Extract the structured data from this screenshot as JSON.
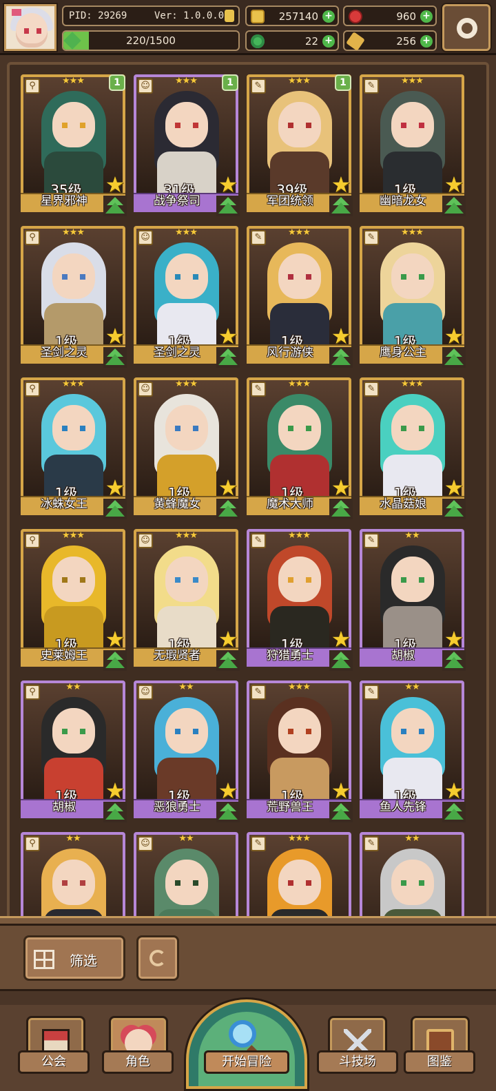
{
  "hud": {
    "pid": "PID: 29269",
    "version": "Ver: 1.0.0.0",
    "exp_text": "220/1500",
    "exp_fraction": 0.147,
    "coins": "257140",
    "gems": "960",
    "clovers": "22",
    "keys": "256",
    "plus": "+",
    "icons": {
      "avatar": "player-avatar",
      "settings": "gear-icon",
      "coin": "coin-icon",
      "gem": "gem-icon",
      "clover": "clover-icon",
      "key": "key-icon"
    }
  },
  "cards": [
    {
      "name": "星界邪神",
      "level": "35级",
      "stars": "★★★",
      "badge": "1",
      "rarity": "gold",
      "hair": "#2f6b5a",
      "body": "#2b4a3c",
      "eyes": "#e0a22a"
    },
    {
      "name": "战争祭司",
      "level": "31级",
      "stars": "★★★",
      "badge": "1",
      "rarity": "purple",
      "hair": "#2b2a33",
      "body": "#d8d2c8",
      "eyes": "#c03636"
    },
    {
      "name": "军团统领",
      "level": "39级",
      "stars": "★★★",
      "badge": "1",
      "rarity": "gold",
      "hair": "#e8c27a",
      "body": "#5a3a2a",
      "eyes": "#b03030"
    },
    {
      "name": "幽暗龙女",
      "level": "1级",
      "stars": "★★★",
      "badge": "",
      "rarity": "gold",
      "hair": "#4a5a52",
      "body": "#2a2d30",
      "eyes": "#c03040"
    },
    {
      "name": "圣剑之灵",
      "level": "1级",
      "stars": "★★★",
      "badge": "",
      "rarity": "gold",
      "hair": "#d9dde8",
      "body": "#b49a6a",
      "eyes": "#4a7ac0"
    },
    {
      "name": "圣剑之灵",
      "level": "1级",
      "stars": "★★★",
      "badge": "",
      "rarity": "gold",
      "hair": "#3ab0c8",
      "body": "#e8e8f0",
      "eyes": "#2a8ab8"
    },
    {
      "name": "风行游侠",
      "level": "1级",
      "stars": "★★★",
      "badge": "",
      "rarity": "gold",
      "hair": "#e7b85a",
      "body": "#2a2d3a",
      "eyes": "#b03040"
    },
    {
      "name": "鹰身公主",
      "level": "1级",
      "stars": "★★★",
      "badge": "",
      "rarity": "gold",
      "hair": "#edd49a",
      "body": "#4aa0a8",
      "eyes": "#3a9a4a"
    },
    {
      "name": "冰蛛女王",
      "level": "1级",
      "stars": "★★★",
      "badge": "",
      "rarity": "gold",
      "hair": "#5ac8dc",
      "body": "#2a3a48",
      "eyes": "#2a80c0"
    },
    {
      "name": "黄蜂魔女",
      "level": "1级",
      "stars": "★★★",
      "badge": "",
      "rarity": "gold",
      "hair": "#e8e4dc",
      "body": "#d4a02a",
      "eyes": "#3a7ac0"
    },
    {
      "name": "魔术大师",
      "level": "1级",
      "stars": "★★★",
      "badge": "",
      "rarity": "gold",
      "hair": "#3a8a68",
      "body": "#b03030",
      "eyes": "#3a9a4a"
    },
    {
      "name": "水晶菇娘",
      "level": "1级",
      "stars": "★★★",
      "badge": "",
      "rarity": "gold",
      "hair": "#4ad0c0",
      "body": "#e8e8f0",
      "eyes": "#3a9a4a"
    },
    {
      "name": "史莱姆王",
      "level": "1级",
      "stars": "★★★",
      "badge": "",
      "rarity": "gold",
      "hair": "#e8b82a",
      "body": "#c89a20",
      "eyes": "#a07818"
    },
    {
      "name": "无瑕贤者",
      "level": "1级",
      "stars": "★★★",
      "badge": "",
      "rarity": "gold",
      "hair": "#f2dc8a",
      "body": "#e8dcc8",
      "eyes": "#3a8ac8"
    },
    {
      "name": "狩猎勇士",
      "level": "1级",
      "stars": "★★★",
      "badge": "",
      "rarity": "purple",
      "hair": "#c0482a",
      "body": "#2a2820",
      "eyes": "#e0a030"
    },
    {
      "name": "胡椒",
      "level": "1级",
      "stars": "★★",
      "badge": "",
      "rarity": "purple",
      "hair": "#2a2a2a",
      "body": "#9a9088",
      "eyes": "#3a9a4a"
    },
    {
      "name": "胡椒",
      "level": "1级",
      "stars": "★★",
      "badge": "",
      "rarity": "purple",
      "hair": "#2a2a2a",
      "body": "#c84030",
      "eyes": "#3a9a4a"
    },
    {
      "name": "恶狼勇士",
      "level": "1级",
      "stars": "★★",
      "badge": "",
      "rarity": "purple",
      "hair": "#4ab0d8",
      "body": "#6a3a28",
      "eyes": "#2a80c0"
    },
    {
      "name": "荒野兽王",
      "level": "1级",
      "stars": "★★★",
      "badge": "",
      "rarity": "purple",
      "hair": "#5a3020",
      "body": "#c89a60",
      "eyes": "#b04020"
    },
    {
      "name": "鱼人先锋",
      "level": "1级",
      "stars": "★★",
      "badge": "",
      "rarity": "purple",
      "hair": "#4ac0d8",
      "body": "#e8e8f0",
      "eyes": "#2a80c0"
    },
    {
      "name": "",
      "level": "",
      "stars": "★★",
      "badge": "",
      "rarity": "purple",
      "hair": "#e8b050",
      "body": "#2a2a30",
      "eyes": "#b04040"
    },
    {
      "name": "",
      "level": "",
      "stars": "★★",
      "badge": "",
      "rarity": "purple",
      "hair": "#5a8a6a",
      "body": "#4a7a5a",
      "eyes": "#2a4a2a"
    },
    {
      "name": "",
      "level": "",
      "stars": "★★★",
      "badge": "",
      "rarity": "purple",
      "hair": "#e89a2a",
      "body": "#2a2a2a",
      "eyes": "#b03030"
    },
    {
      "name": "",
      "level": "",
      "stars": "★★",
      "badge": "",
      "rarity": "purple",
      "hair": "#c8c8c8",
      "body": "#4a5a3a",
      "eyes": "#3a9a4a"
    }
  ],
  "toolbar": {
    "filter_label": "筛选",
    "filter_icon": "grid-icon",
    "reset_icon": "refresh-icon"
  },
  "nav": {
    "guild": "公会",
    "characters": "角色",
    "adventure": "开始冒险",
    "arena": "斗技场",
    "codex": "图鉴"
  }
}
